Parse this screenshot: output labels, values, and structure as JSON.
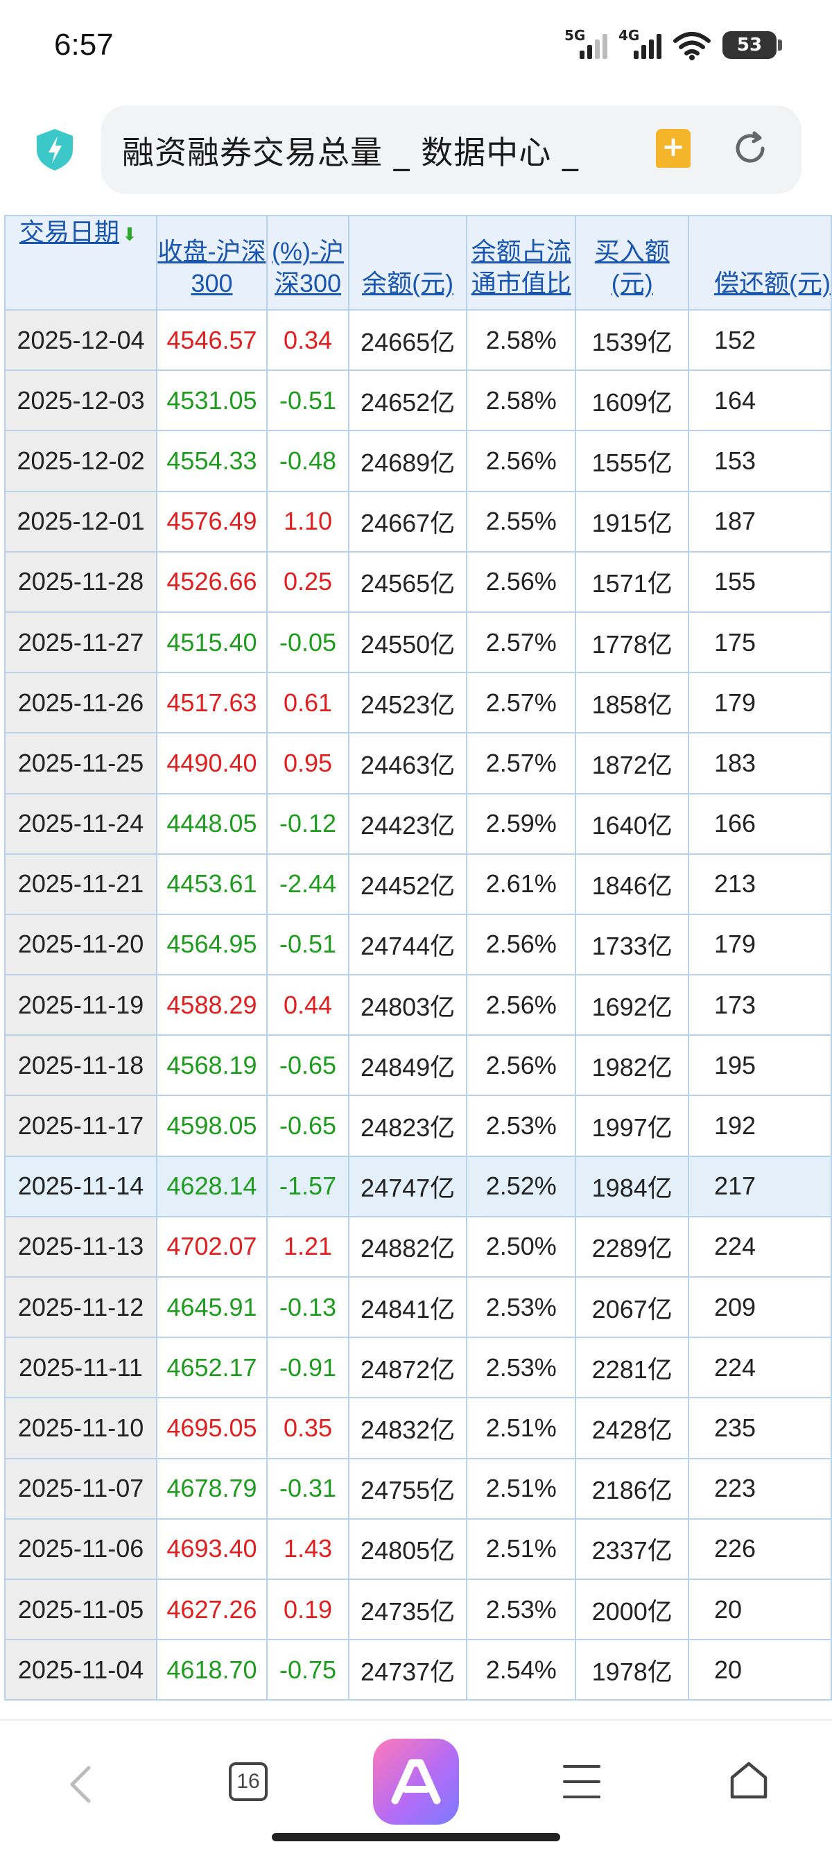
{
  "status": {
    "time": "6:57",
    "signal1_label": "5G",
    "signal2_label": "4G",
    "battery": "53"
  },
  "browser": {
    "title": "融资融券交易总量 _ 数据中心 _",
    "tab_count": "16"
  },
  "table": {
    "headers": {
      "date": "交易日期",
      "close": "收盘-沪深300",
      "change": "(%)-沪深300",
      "balance": "余额(元)",
      "ratio": "余额占流通市值比",
      "buy": "买入额(元)",
      "repay": "偿还额(元)"
    },
    "rows": [
      {
        "date": "2025-12-04",
        "close": "4546.57",
        "change": "0.34",
        "balance": "24665亿",
        "ratio": "2.58%",
        "buy": "1539亿",
        "repay": "152",
        "dir": "up"
      },
      {
        "date": "2025-12-03",
        "close": "4531.05",
        "change": "-0.51",
        "balance": "24652亿",
        "ratio": "2.58%",
        "buy": "1609亿",
        "repay": "164",
        "dir": "down"
      },
      {
        "date": "2025-12-02",
        "close": "4554.33",
        "change": "-0.48",
        "balance": "24689亿",
        "ratio": "2.56%",
        "buy": "1555亿",
        "repay": "153",
        "dir": "down"
      },
      {
        "date": "2025-12-01",
        "close": "4576.49",
        "change": "1.10",
        "balance": "24667亿",
        "ratio": "2.55%",
        "buy": "1915亿",
        "repay": "187",
        "dir": "up"
      },
      {
        "date": "2025-11-28",
        "close": "4526.66",
        "change": "0.25",
        "balance": "24565亿",
        "ratio": "2.56%",
        "buy": "1571亿",
        "repay": "155",
        "dir": "up"
      },
      {
        "date": "2025-11-27",
        "close": "4515.40",
        "change": "-0.05",
        "balance": "24550亿",
        "ratio": "2.57%",
        "buy": "1778亿",
        "repay": "175",
        "dir": "down"
      },
      {
        "date": "2025-11-26",
        "close": "4517.63",
        "change": "0.61",
        "balance": "24523亿",
        "ratio": "2.57%",
        "buy": "1858亿",
        "repay": "179",
        "dir": "up"
      },
      {
        "date": "2025-11-25",
        "close": "4490.40",
        "change": "0.95",
        "balance": "24463亿",
        "ratio": "2.57%",
        "buy": "1872亿",
        "repay": "183",
        "dir": "up"
      },
      {
        "date": "2025-11-24",
        "close": "4448.05",
        "change": "-0.12",
        "balance": "24423亿",
        "ratio": "2.59%",
        "buy": "1640亿",
        "repay": "166",
        "dir": "down"
      },
      {
        "date": "2025-11-21",
        "close": "4453.61",
        "change": "-2.44",
        "balance": "24452亿",
        "ratio": "2.61%",
        "buy": "1846亿",
        "repay": "213",
        "dir": "down"
      },
      {
        "date": "2025-11-20",
        "close": "4564.95",
        "change": "-0.51",
        "balance": "24744亿",
        "ratio": "2.56%",
        "buy": "1733亿",
        "repay": "179",
        "dir": "down"
      },
      {
        "date": "2025-11-19",
        "close": "4588.29",
        "change": "0.44",
        "balance": "24803亿",
        "ratio": "2.56%",
        "buy": "1692亿",
        "repay": "173",
        "dir": "up"
      },
      {
        "date": "2025-11-18",
        "close": "4568.19",
        "change": "-0.65",
        "balance": "24849亿",
        "ratio": "2.56%",
        "buy": "1982亿",
        "repay": "195",
        "dir": "down"
      },
      {
        "date": "2025-11-17",
        "close": "4598.05",
        "change": "-0.65",
        "balance": "24823亿",
        "ratio": "2.53%",
        "buy": "1997亿",
        "repay": "192",
        "dir": "down"
      },
      {
        "date": "2025-11-14",
        "close": "4628.14",
        "change": "-1.57",
        "balance": "24747亿",
        "ratio": "2.52%",
        "buy": "1984亿",
        "repay": "217",
        "dir": "down",
        "highlight": true
      },
      {
        "date": "2025-11-13",
        "close": "4702.07",
        "change": "1.21",
        "balance": "24882亿",
        "ratio": "2.50%",
        "buy": "2289亿",
        "repay": "224",
        "dir": "up"
      },
      {
        "date": "2025-11-12",
        "close": "4645.91",
        "change": "-0.13",
        "balance": "24841亿",
        "ratio": "2.53%",
        "buy": "2067亿",
        "repay": "209",
        "dir": "down"
      },
      {
        "date": "2025-11-11",
        "close": "4652.17",
        "change": "-0.91",
        "balance": "24872亿",
        "ratio": "2.53%",
        "buy": "2281亿",
        "repay": "224",
        "dir": "down"
      },
      {
        "date": "2025-11-10",
        "close": "4695.05",
        "change": "0.35",
        "balance": "24832亿",
        "ratio": "2.51%",
        "buy": "2428亿",
        "repay": "235",
        "dir": "up"
      },
      {
        "date": "2025-11-07",
        "close": "4678.79",
        "change": "-0.31",
        "balance": "24755亿",
        "ratio": "2.51%",
        "buy": "2186亿",
        "repay": "223",
        "dir": "down"
      },
      {
        "date": "2025-11-06",
        "close": "4693.40",
        "change": "1.43",
        "balance": "24805亿",
        "ratio": "2.51%",
        "buy": "2337亿",
        "repay": "226",
        "dir": "up"
      },
      {
        "date": "2025-11-05",
        "close": "4627.26",
        "change": "0.19",
        "balance": "24735亿",
        "ratio": "2.53%",
        "buy": "2000亿",
        "repay": "20",
        "dir": "up"
      },
      {
        "date": "2025-11-04",
        "close": "4618.70",
        "change": "-0.75",
        "balance": "24737亿",
        "ratio": "2.54%",
        "buy": "1978亿",
        "repay": "20",
        "dir": "down"
      }
    ]
  },
  "colors": {
    "up": "#e02020",
    "down": "#1f9b1f",
    "header_bg": "#e8f1fb",
    "link": "#1a56b0",
    "border": "#b9d2ec"
  }
}
